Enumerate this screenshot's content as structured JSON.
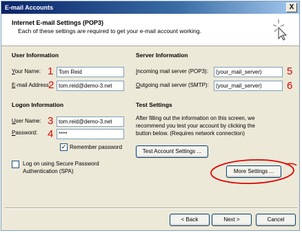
{
  "window": {
    "title": "E-mail Accounts",
    "close_label": "X"
  },
  "header": {
    "title": "Internet E-mail Settings (POP3)",
    "subtitle": "Each of these settings are required to get your e-mail account working."
  },
  "user_info": {
    "heading": "User Information",
    "name_label": "Your Name:",
    "name_value": "Tom Reid",
    "email_label": "E-mail Address:",
    "email_value": "tom.reid@demo-3.net"
  },
  "server_info": {
    "heading": "Server Information",
    "incoming_label": "Incoming mail server (POP3):",
    "incoming_value": "(your_mail_server)",
    "outgoing_label": "Outgoing mail server (SMTP):",
    "outgoing_value": "(your_mail_server)"
  },
  "logon_info": {
    "heading": "Logon Information",
    "user_label": "User Name:",
    "user_value": "tom.reid@demo-3.net",
    "password_label": "Password:",
    "password_value": "****",
    "remember_label": "Remember password",
    "remember_checked": true,
    "spa_label": "Log on using Secure Password Authentication (SPA)",
    "spa_checked": false
  },
  "test_settings": {
    "heading": "Test Settings",
    "description": "After filling out the information on this screen, we recommend you test your account by clicking the button below. (Requires network connection)",
    "test_button": "Test Account Settings ...",
    "more_button": "More Settings ..."
  },
  "annotations": {
    "numbers": [
      "1",
      "2",
      "3",
      "4",
      "5",
      "6"
    ],
    "color": "#e00000"
  },
  "footer": {
    "back": "< Back",
    "next": "Next >",
    "cancel": "Cancel"
  }
}
